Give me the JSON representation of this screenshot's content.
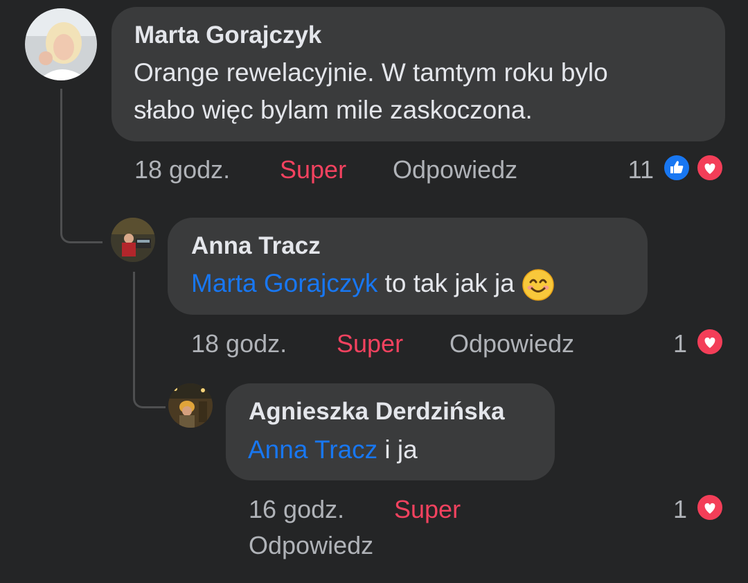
{
  "comments": [
    {
      "author": "Marta Gorajczyk",
      "text_line1": "Orange rewelacyjnie. W tamtym roku bylo",
      "text_line2": "słabo więc bylam mile zaskoczona.",
      "time": "18 godz.",
      "react_label": "Super",
      "reply_label": "Odpowiedz",
      "reaction_count": "11",
      "reactions": [
        "like-icon",
        "love-icon"
      ]
    },
    {
      "author": "Anna Tracz",
      "mention": "Marta Gorajczyk",
      "text": " to tak jak ja ",
      "emoji": "smiling-face-icon",
      "time": "18 godz.",
      "react_label": "Super",
      "reply_label": "Odpowiedz",
      "reaction_count": "1",
      "reactions": [
        "love-icon"
      ]
    },
    {
      "author": "Agnieszka Derdzińska",
      "mention": "Anna Tracz",
      "text": " i ja",
      "time": "16 godz.",
      "react_label": "Super",
      "reply_label": "Odpowiedz",
      "reaction_count": "1",
      "reactions": [
        "love-icon"
      ]
    }
  ],
  "colors": {
    "background": "#242526",
    "bubble": "#3a3b3c",
    "text": "#e4e6eb",
    "secondary_text": "#b0b3b8",
    "mention": "#1877f2",
    "super_reaction": "#f3425f",
    "like_blue": "#1877f2",
    "love_red": "#f33e58"
  }
}
